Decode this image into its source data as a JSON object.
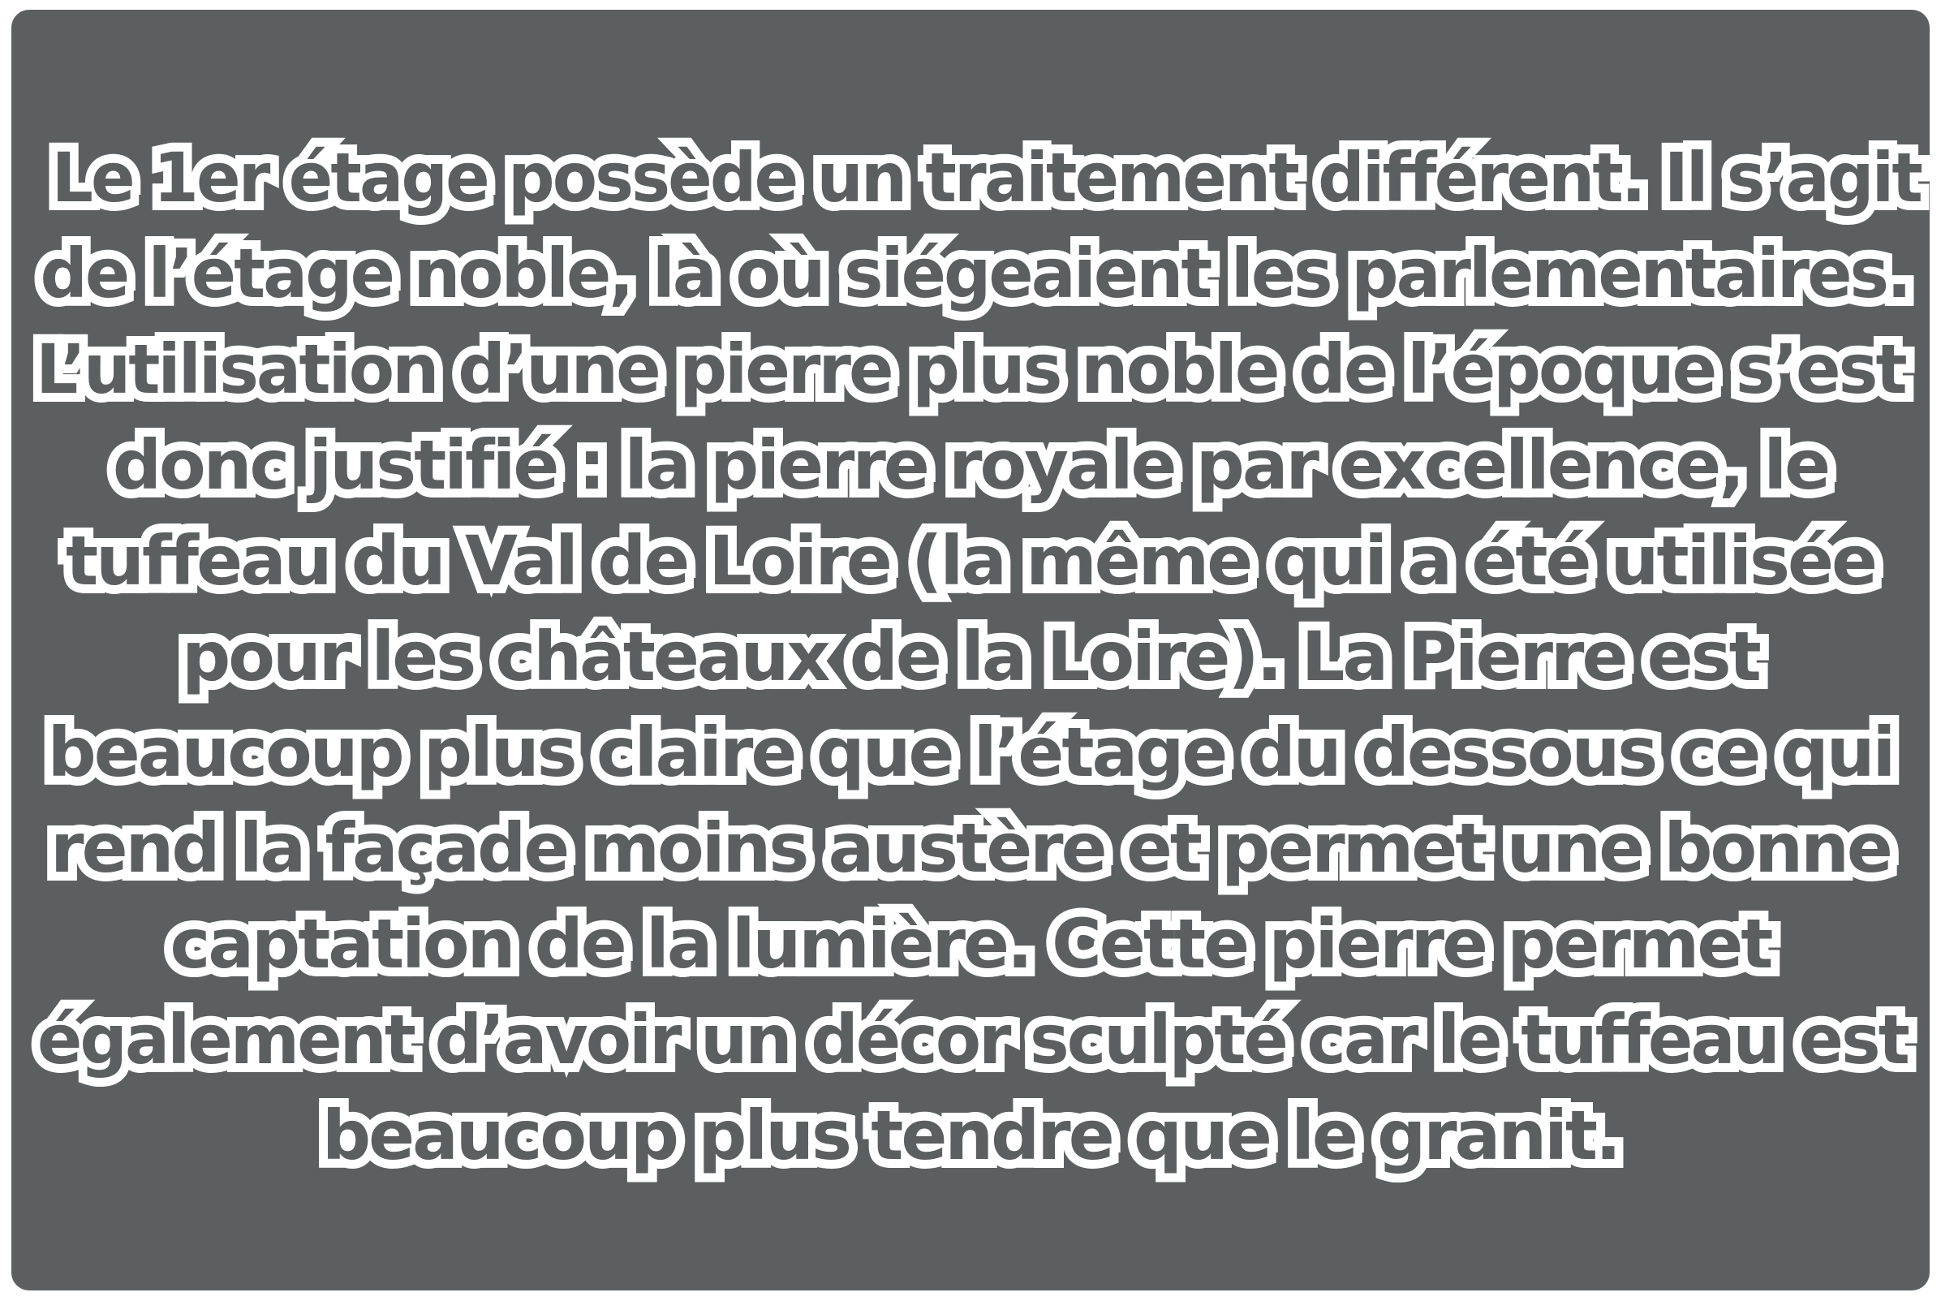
{
  "panel": {
    "background": "#5c5f60",
    "text_fill": "#5c5f60",
    "text_outline": "#ffffff"
  },
  "paragraph": {
    "lines": [
      "Le 1er étage possède un traitement différent. Il s’agit",
      "de l’étage noble, là où siégeaient les parlementaires.",
      "L’utilisation d’une pierre plus noble de l’époque s’est",
      "donc justifié : la pierre royale par excellence, le",
      "tuffeau du Val de Loire (la même qui a été utilisée",
      "pour les châteaux de la Loire). La Pierre est",
      "beaucoup plus claire que l’étage du dessous ce qui",
      "rend la façade moins austère et permet une bonne",
      "captation de la lumière. Cette pierre permet",
      "également d’avoir un décor sculpté car le tuffeau est",
      "beaucoup plus tendre que le granit."
    ]
  }
}
